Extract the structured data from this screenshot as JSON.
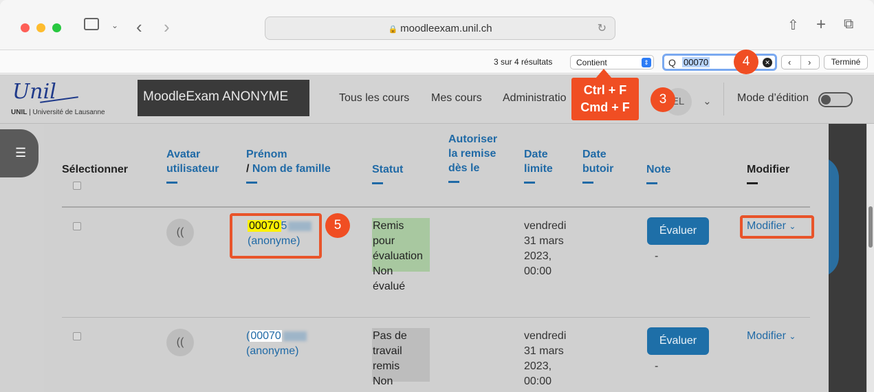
{
  "browser": {
    "url": "moodleexam.unil.ch",
    "find": {
      "result_count": "3 sur 4 résultats",
      "match_mode": "Contient",
      "query": "00070",
      "done_label": "Terminé"
    }
  },
  "site": {
    "logo_script": "Unil",
    "logo_subtitle_bold": "UNIL",
    "logo_subtitle": " | Université de Lausanne",
    "brand": "MoodleExam ANONYME",
    "nav": [
      "Tous les cours",
      "Mes cours",
      "Administratio"
    ],
    "user_initials": "EL",
    "edit_mode_label": "Mode d’édition"
  },
  "table": {
    "headers": {
      "select": "Sélectionner",
      "avatar_1": "Avatar",
      "avatar_2": "utilisateur",
      "first_name": "Prénom",
      "slash": "/",
      "last_name": "Nom de famille",
      "status": "Statut",
      "allow_1": "Autoriser",
      "allow_2": "la remise",
      "allow_3": "dès le",
      "due_1": "Date",
      "due_2": "limite",
      "cutoff_1": "Date",
      "cutoff_2": "butoir",
      "grade": "Note",
      "modify": "Modifier"
    },
    "rows": [
      {
        "avatar": "((",
        "id_match": "00070",
        "id_rest": "5",
        "anon": "(anonyme)",
        "status": [
          "Remis",
          "pour",
          "évaluation",
          "Non",
          "évalué"
        ],
        "due": [
          "vendredi",
          "31 mars",
          "2023,",
          "00:00"
        ],
        "grade_button": "Évaluer",
        "grade_value": "-",
        "modify": "Modifier"
      },
      {
        "avatar": "((",
        "id_prefix": "(",
        "id_match": "00070",
        "anon": "(anonyme)",
        "status": [
          "Pas de",
          "travail",
          "remis",
          "Non"
        ],
        "due": [
          "vendredi",
          "31 mars",
          "2023,",
          "00:00"
        ],
        "grade_button": "Évaluer",
        "grade_value": "-",
        "modify": "Modifier"
      }
    ]
  },
  "annotations": {
    "step3": "3",
    "step4": "4",
    "step5": "5",
    "shortcut_line1": "Ctrl + F",
    "shortcut_line2": "Cmd + F"
  },
  "colors": {
    "accent_blue": "#206aa6",
    "annotation_orange": "#f04e23",
    "find_highlight": "#fff200",
    "status_submitted": "#a8c8a0",
    "status_none": "#bdbdbd"
  },
  "icons": {
    "lock": "🔒",
    "reload": "↻",
    "share": "⇧",
    "new_tab": "+",
    "tabs": "⧉",
    "sidebar": "▯",
    "back": "‹",
    "forward": "›",
    "search": "Q",
    "clear": "✕",
    "menu": "☰",
    "chevron_down": "⌄"
  }
}
